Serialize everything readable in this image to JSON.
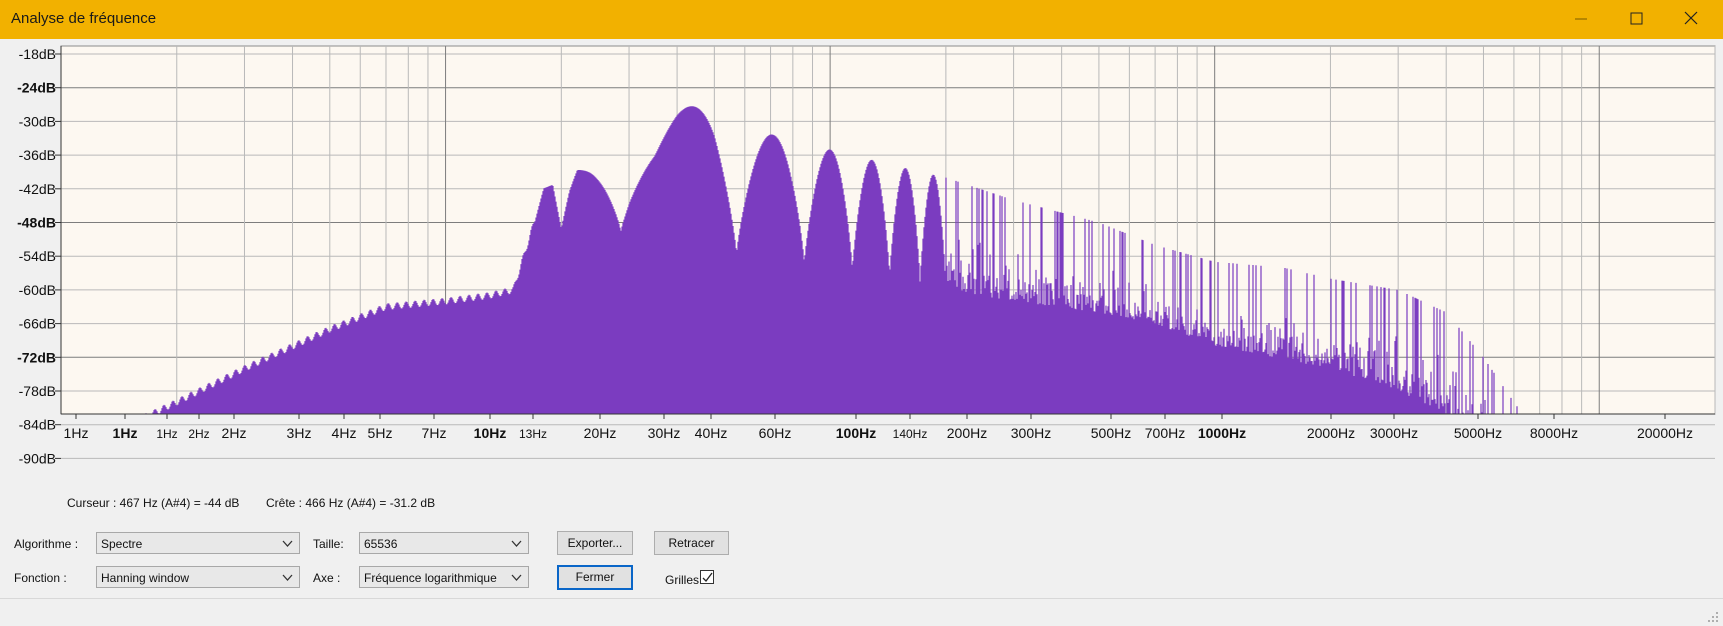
{
  "window": {
    "title": "Analyse de fréquence",
    "controls": [
      "minimize-icon",
      "maximize-icon",
      "close-icon"
    ]
  },
  "colors": {
    "titlebar": "#f2b100",
    "plot_background": "#fdf8f1",
    "spectrum_fill": "#7b3cc0",
    "grid": "#b4b4b4"
  },
  "chart_data": {
    "type": "area",
    "xscale": "log",
    "xlim": [
      1,
      20000
    ],
    "ylim": [
      -90,
      -18
    ],
    "grid": true,
    "y_ticks": [
      {
        "label": "-18dB",
        "bold": false
      },
      {
        "label": "-24dB",
        "bold": true
      },
      {
        "label": "-30dB",
        "bold": false
      },
      {
        "label": "-36dB",
        "bold": false
      },
      {
        "label": "-42dB",
        "bold": false
      },
      {
        "label": "-48dB",
        "bold": true
      },
      {
        "label": "-54dB",
        "bold": false
      },
      {
        "label": "-60dB",
        "bold": false
      },
      {
        "label": "-66dB",
        "bold": false
      },
      {
        "label": "-72dB",
        "bold": true
      },
      {
        "label": "-78dB",
        "bold": false
      },
      {
        "label": "-84dB",
        "bold": false
      },
      {
        "label": "-90dB",
        "bold": false
      }
    ],
    "x_ticks": [
      {
        "label": "1Hz",
        "bold": false
      },
      {
        "label": "1Hz",
        "bold": true
      },
      {
        "label": "1Hz",
        "bold": false,
        "small": true
      },
      {
        "label": "2Hz",
        "bold": false,
        "small": true
      },
      {
        "label": "2Hz",
        "bold": false
      },
      {
        "label": "3Hz",
        "bold": false
      },
      {
        "label": "4Hz",
        "bold": false
      },
      {
        "label": "5Hz",
        "bold": false
      },
      {
        "label": "7Hz",
        "bold": false
      },
      {
        "label": "10Hz",
        "bold": true
      },
      {
        "label": "13Hz",
        "bold": false,
        "small": true
      },
      {
        "label": "20Hz",
        "bold": false
      },
      {
        "label": "30Hz",
        "bold": false
      },
      {
        "label": "40Hz",
        "bold": false
      },
      {
        "label": "60Hz",
        "bold": false
      },
      {
        "label": "100Hz",
        "bold": true
      },
      {
        "label": "140Hz",
        "bold": false,
        "small": true
      },
      {
        "label": "200Hz",
        "bold": false
      },
      {
        "label": "300Hz",
        "bold": false
      },
      {
        "label": "500Hz",
        "bold": false
      },
      {
        "label": "700Hz",
        "bold": false
      },
      {
        "label": "1000Hz",
        "bold": true
      },
      {
        "label": "2000Hz",
        "bold": false
      },
      {
        "label": "3000Hz",
        "bold": false
      },
      {
        "label": "5000Hz",
        "bold": false
      },
      {
        "label": "8000Hz",
        "bold": false
      },
      {
        "label": "20000Hz",
        "bold": false
      }
    ],
    "envelope": {
      "x": [
        1,
        1.5,
        2,
        3,
        5,
        7,
        10,
        13,
        15,
        17,
        18,
        19,
        20,
        21,
        22,
        24,
        26,
        28,
        30,
        35,
        40,
        50,
        60,
        80,
        100,
        150,
        200,
        300,
        500,
        700,
        1000,
        1500,
        2000,
        3000,
        4000,
        5000,
        6000,
        7000,
        8000,
        20000
      ],
      "y": [
        -88,
        -84,
        -80,
        -74,
        -67,
        -63,
        -62,
        -61,
        -60,
        -48,
        -41,
        -40,
        -48,
        -40,
        -35,
        -32,
        -30,
        -29,
        -27,
        -30,
        -28,
        -26,
        -30,
        -34,
        -35,
        -38,
        -40,
        -44,
        -48,
        -52,
        -55,
        -56,
        -58,
        -60,
        -64,
        -72,
        -80,
        -86,
        -90,
        -92
      ]
    },
    "floor": {
      "x": [
        1,
        2,
        3,
        5,
        7,
        10,
        13,
        15,
        17,
        19,
        20,
        22,
        30,
        40,
        60,
        100,
        150,
        200,
        300,
        500,
        700,
        1000,
        2000,
        3000,
        4000,
        5000,
        6000,
        8000
      ],
      "y": [
        -89,
        -82,
        -76,
        -68,
        -64,
        -62,
        -61,
        -60,
        -58,
        -52,
        -55,
        -48,
        -50,
        -52,
        -54,
        -56,
        -58,
        -60,
        -62,
        -64,
        -66,
        -70,
        -74,
        -78,
        -82,
        -86,
        -90,
        -95
      ]
    }
  },
  "readout": {
    "cursor": "Curseur : 467 Hz (A#4) = -44 dB",
    "peak": "Crête : 466 Hz (A#4) = -31.2 dB"
  },
  "controls": {
    "algorithm_label": "Algorithme :",
    "algorithm_value": "Spectre",
    "size_label": "Taille:",
    "size_value": "65536",
    "function_label": "Fonction :",
    "function_value": "Hanning window",
    "axis_label": "Axe :",
    "axis_value": "Fréquence logarithmique",
    "export_label": "Exporter...",
    "replot_label": "Retracer",
    "close_label": "Fermer",
    "grids_label": "Grilles",
    "grids_checked": true
  }
}
